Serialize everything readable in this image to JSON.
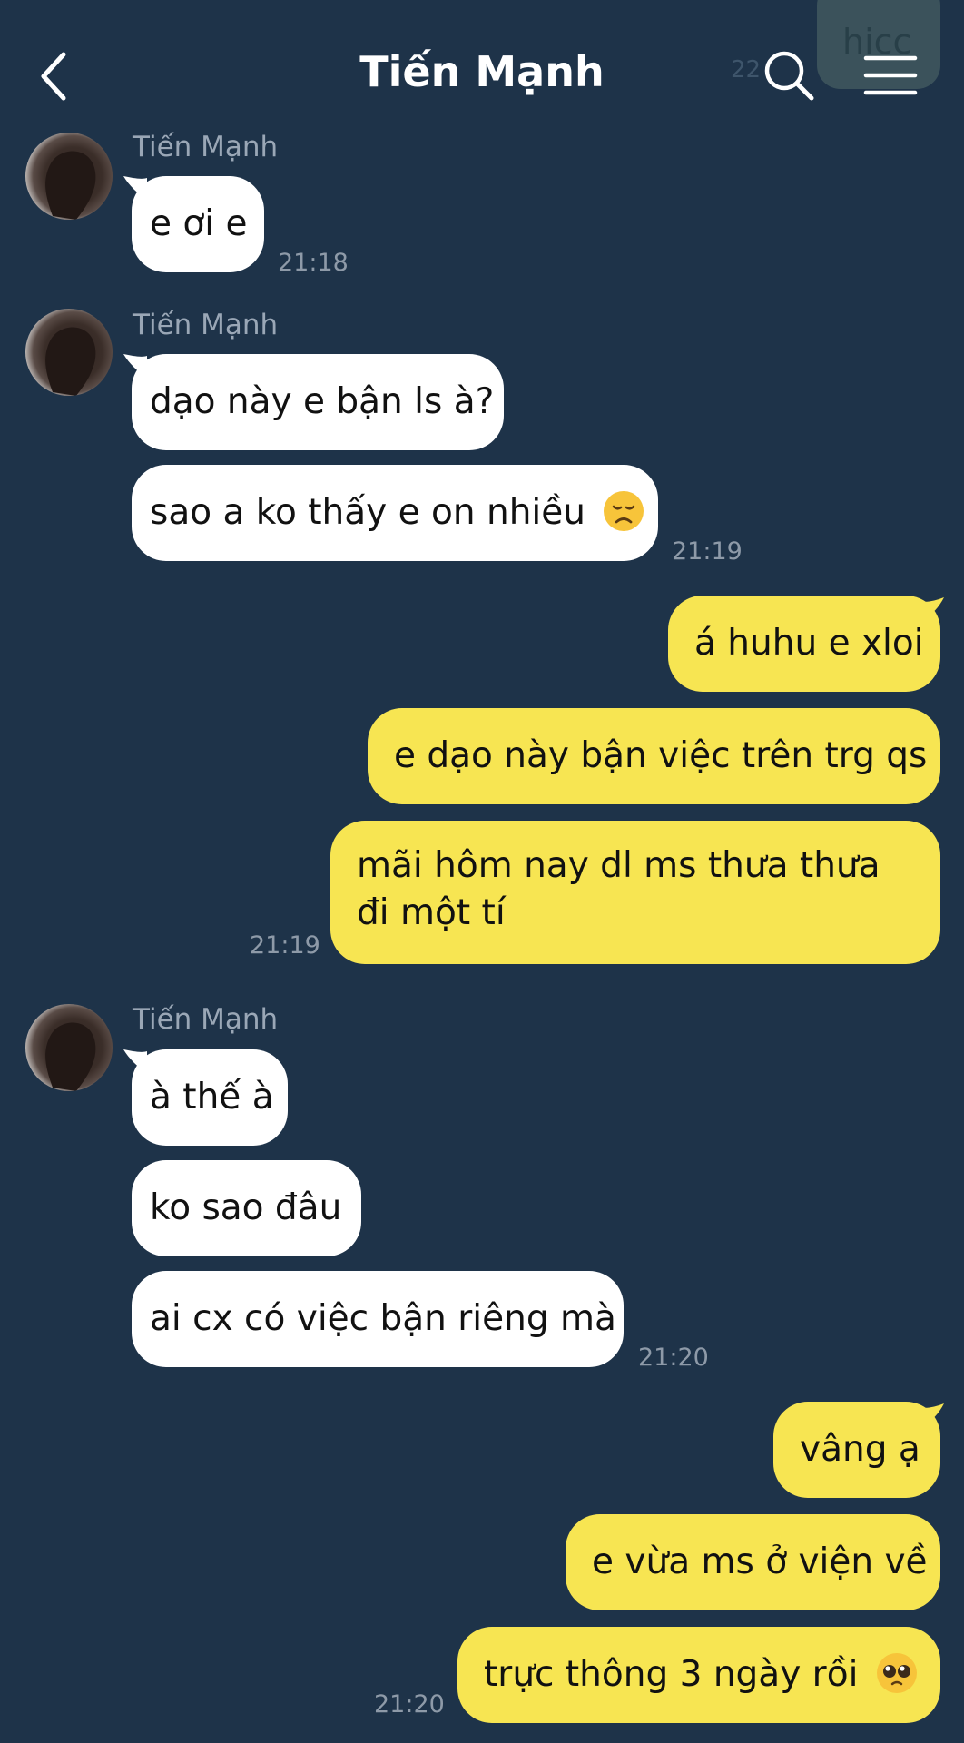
{
  "header": {
    "title": "Tiến Mạnh",
    "ghost_bubble_text": "hicc",
    "ghost_time": "22"
  },
  "contact": {
    "name": "Tiến Mạnh"
  },
  "colors": {
    "background": "#1e3349",
    "incoming_bubble": "#ffffff",
    "outgoing_bubble": "#f7e552",
    "timestamp": "#8e9aa8",
    "sender_name": "#9aa7b6"
  },
  "icons": {
    "back": "chevron-left-icon",
    "search": "search-icon",
    "menu": "hamburger-menu-icon",
    "sad_face": "disappointed-face-emoji",
    "pleading_face": "pleading-face-emoji"
  },
  "messages": [
    {
      "direction": "in",
      "text": "e ơi e"
    },
    {
      "direction": "in",
      "text": "dạo này e bận ls à?"
    },
    {
      "direction": "in",
      "text": "sao a ko thấy e on nhiều"
    },
    {
      "direction": "out",
      "text": "á huhu e xloi"
    },
    {
      "direction": "out",
      "text": "e dạo này bận việc trên trg qs"
    },
    {
      "direction": "out",
      "text": "mãi hôm nay dl ms thưa thưa đi một tí"
    },
    {
      "direction": "in",
      "text": "à thế à"
    },
    {
      "direction": "in",
      "text": "ko sao đâu"
    },
    {
      "direction": "in",
      "text": "ai cx có việc bận riêng mà"
    },
    {
      "direction": "out",
      "text": "vâng ạ"
    },
    {
      "direction": "out",
      "text": "e vừa ms ở viện về"
    },
    {
      "direction": "out",
      "text": "trực thông 3 ngày rồi"
    }
  ],
  "timestamps": [
    "21:18",
    "21:19",
    "21:19",
    "21:20",
    "21:20"
  ]
}
